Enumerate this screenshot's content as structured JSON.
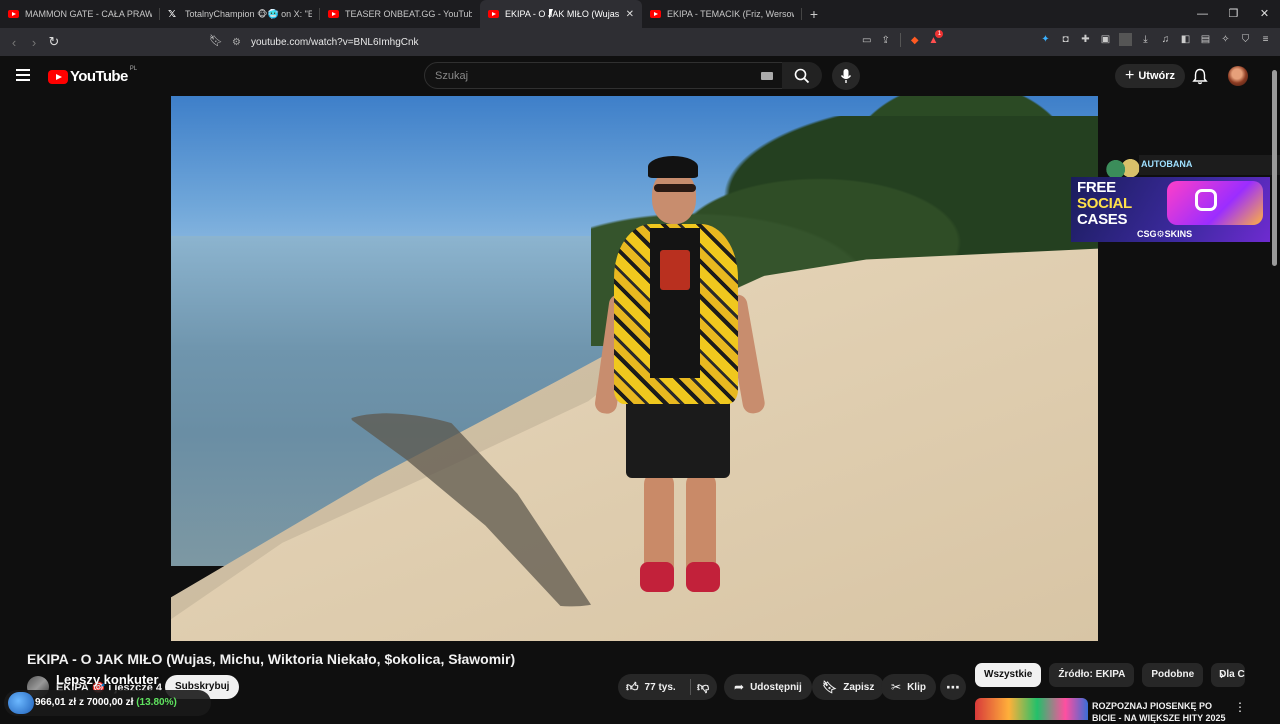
{
  "browser": {
    "tabs": [
      {
        "label": "MAMMON GATE - CAŁA PRAWDA - Y",
        "icon": "youtube-icon",
        "active": false
      },
      {
        "label": "TotalnyChampion 🐵🥶 on X: \"EOJ S",
        "icon": "x-icon",
        "active": false
      },
      {
        "label": "TEASER ONBEAT.GG - YouTube",
        "icon": "youtube-icon",
        "active": false
      },
      {
        "label": "EKIPA - O JAK MIŁO (Wujas, Mich",
        "icon": "youtube-icon",
        "active": true
      },
      {
        "label": "EKIPA - TEMACIK (Friz, Wersow, Kosto",
        "icon": "youtube-icon",
        "active": false
      }
    ],
    "new_tab": "+",
    "url": "youtube.com/watch?v=BNL6ImhgCnk",
    "badge_count": "1",
    "window_controls": [
      "—",
      "❐",
      "✕"
    ]
  },
  "youtube": {
    "logo_text": "YouTube",
    "country_code": "PL",
    "search_placeholder": "Szukaj",
    "create_label": "Utwórz",
    "create_icon": "+"
  },
  "ad": {
    "tag": "AUTOBANA",
    "line1": "FREE",
    "line2": "SOCIAL",
    "line3": "CASES",
    "brand": "CSG⚙SKINS"
  },
  "video": {
    "title": "EKIPA - O JAK MIŁO (Wujas, Michu, Wiktoria Niekało, $okolica, Sławomir)",
    "channel": "EKIPA 🎯 i jeszcze 4",
    "channel_overlay": "Lepszy konkuter",
    "subscribe_label": "Subskrybuj",
    "likes": "77 tys.",
    "share_label": "Udostępnij",
    "save_label": "Zapisz",
    "clip_label": "Klip",
    "more_label": "⋯"
  },
  "donation": {
    "amount": "966,01 zł",
    "of_label": "z",
    "goal": "7000,00 zł",
    "percent": "(13.80%)"
  },
  "related": {
    "chips": [
      "Wszystkie",
      "Źródło: EKIPA",
      "Podobne",
      "Dla C"
    ],
    "first_title": "ROZPOZNAJ PIOSENKĘ PO BICIE - NA WIĘKSZE HITY 2025"
  }
}
